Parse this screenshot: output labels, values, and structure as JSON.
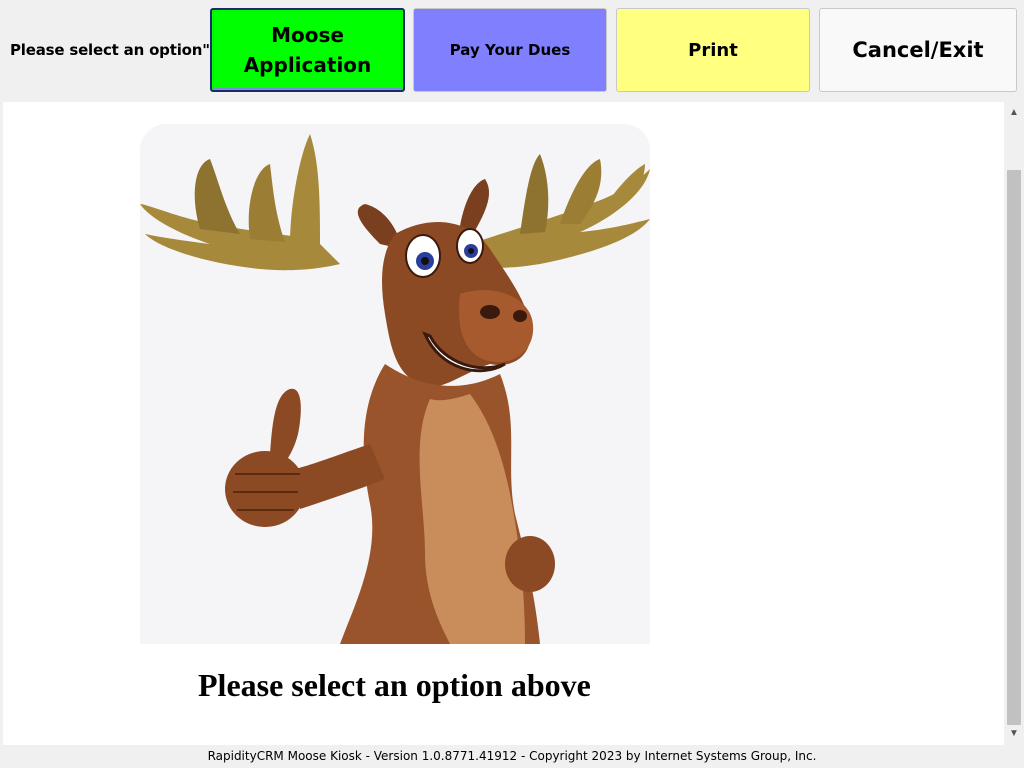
{
  "header": {
    "prompt": "Please select an option\""
  },
  "buttons": {
    "moose_application": {
      "line1": "Moose",
      "line2": "Application",
      "color": "#00ff00"
    },
    "pay_dues": {
      "label": "Pay Your Dues",
      "color": "#8080ff"
    },
    "print": {
      "label": "Print",
      "color": "#ffff80"
    },
    "cancel": {
      "label": "Cancel/Exit",
      "color": "#f9f9f9"
    }
  },
  "main": {
    "image_icon": "moose-mascot-thumbs-up",
    "caption": "Please select an option above"
  },
  "footer": {
    "text": "RapidityCRM Moose Kiosk - Version 1.0.8771.41912 - Copyright 2023 by Internet Systems Group, Inc."
  }
}
